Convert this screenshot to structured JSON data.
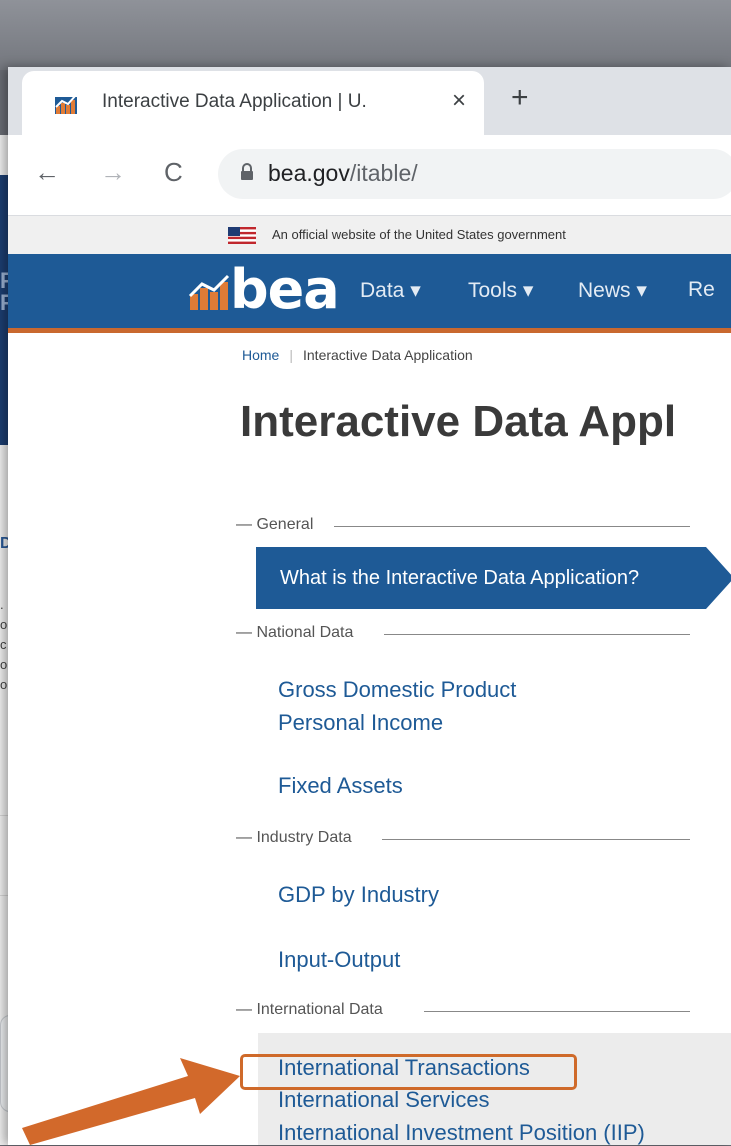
{
  "browser": {
    "tab_title": "Interactive Data Application | U.",
    "tab_close": "×",
    "new_tab": "+",
    "back": "←",
    "forward": "→",
    "reload": "C",
    "url_host": "bea.gov",
    "url_path": "/itable/"
  },
  "gov_banner": "An official website of the United States government",
  "nav": {
    "logo": "bea",
    "items": [
      {
        "label": "Data ▾"
      },
      {
        "label": "Tools ▾"
      },
      {
        "label": "News ▾"
      },
      {
        "label": "Re"
      }
    ]
  },
  "breadcrumb": {
    "home": "Home",
    "sep": "|",
    "current": "Interactive Data Application"
  },
  "page_title": "Interactive Data Appl",
  "sections": {
    "general": "— General",
    "national": "— National Data",
    "industry": "— Industry Data",
    "international": "— International Data"
  },
  "links": {
    "what_is": "What is the Interactive Data Application?",
    "gdp": "Gross Domestic Product",
    "personal_income": "Personal Income",
    "fixed_assets": "Fixed Assets",
    "gdp_by_industry": "GDP by Industry",
    "input_output": "Input-Output",
    "intl_transactions": "International Transactions",
    "intl_services": "International Services",
    "intl_iip": "International Investment Position (IIP)"
  },
  "background_window": {
    "heading_fragment": "D",
    "text_lines": [
      ".",
      "o",
      "c",
      "o",
      "o"
    ]
  },
  "colors": {
    "bea_blue": "#1e5a96",
    "bea_orange": "#c9682f",
    "highlight": "#cf6a2a"
  }
}
